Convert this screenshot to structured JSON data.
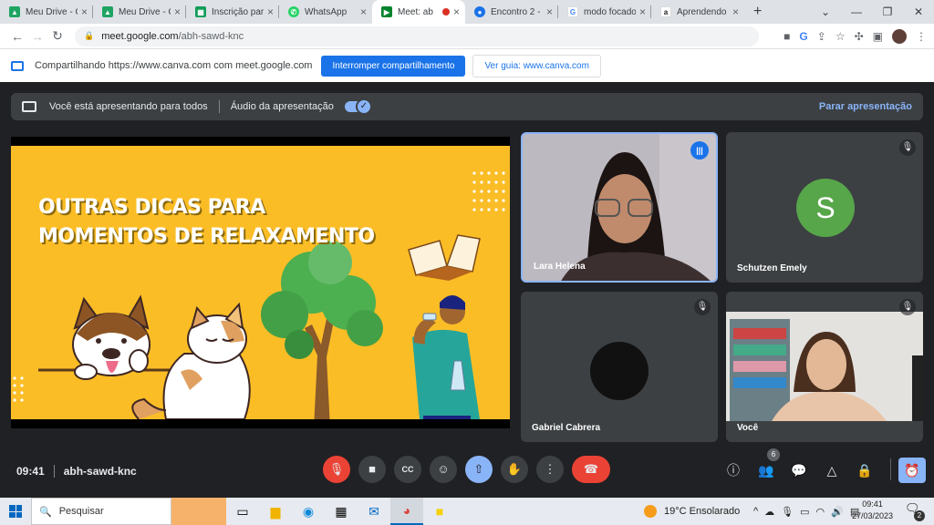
{
  "browser": {
    "tabs": [
      {
        "label": "Meu Drive - G",
        "icon": "google-drive-icon",
        "color": "#1fa463"
      },
      {
        "label": "Meu Drive - G",
        "icon": "google-drive-icon",
        "color": "#1fa463"
      },
      {
        "label": "Inscrição para",
        "icon": "google-sheets-icon",
        "color": "#0f9d58"
      },
      {
        "label": "WhatsApp",
        "icon": "whatsapp-icon",
        "color": "#25d366"
      },
      {
        "label": "Meet: ab",
        "icon": "google-meet-icon",
        "color": "#00832d",
        "recording": true,
        "active": true
      },
      {
        "label": "Encontro 2 - ",
        "icon": "chrome-icon",
        "color": "#1a73e8"
      },
      {
        "label": "modo focado",
        "icon": "google-icon",
        "color": "#4285f4"
      },
      {
        "label": "Aprendendo",
        "icon": "amazon-icon",
        "color": "#222222"
      }
    ],
    "url_host": "meet.google.com",
    "url_path": "/abh-sawd-knc"
  },
  "share_bar": {
    "text": "Compartilhando https://www.canva.com com meet.google.com",
    "stop_button": "Interromper compartilhamento",
    "view_button": "Ver guia: www.canva.com"
  },
  "presenting_bar": {
    "status": "Você está apresentando para todos",
    "audio_label": "Áudio da apresentação",
    "audio_enabled": true,
    "stop_label": "Parar apresentação"
  },
  "slide": {
    "line1": "OUTRAS DICAS PARA",
    "line2": "MOMENTOS DE RELAXAMENTO"
  },
  "participants": [
    {
      "name": "Lara Helena",
      "speaking": true
    },
    {
      "name": "Schutzen Emely",
      "initial": "S",
      "avatar_color": "#57a64a",
      "muted": true
    },
    {
      "name": "Gabriel Cabrera",
      "muted": true
    },
    {
      "name": "Você",
      "muted": true
    }
  ],
  "meeting": {
    "time": "09:41",
    "code": "abh-sawd-knc",
    "participant_count": "6"
  },
  "taskbar": {
    "search_placeholder": "Pesquisar",
    "weather": "19°C  Ensolarado",
    "time": "09:41",
    "date": "27/03/2023",
    "notifications": "2"
  }
}
